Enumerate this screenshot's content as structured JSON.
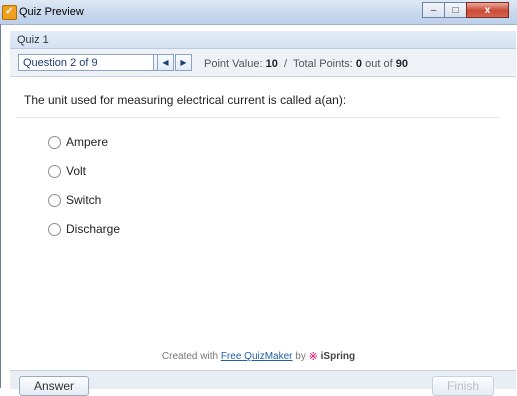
{
  "window": {
    "title": "Quiz Preview",
    "controls": [
      "–",
      "□",
      "x"
    ]
  },
  "quiz": {
    "name": "Quiz 1"
  },
  "toolbar": {
    "question_selector": "Question 2 of 9",
    "prev_glyph": "◀",
    "next_glyph": "▶",
    "point_value_label": "Point Value:",
    "point_value": "10",
    "separator": "/",
    "total_points_label": "Total Points:",
    "total_points": "0",
    "out_of_text": "out of",
    "max_points": "90"
  },
  "question": {
    "text": "The unit used for measuring electrical current is called a(an):",
    "options": [
      "Ampere",
      "Volt",
      "Switch",
      "Discharge"
    ]
  },
  "footer": {
    "created_with": "Created with",
    "link_text": "Free QuizMaker",
    "by_text": "by",
    "brand": "iSpring",
    "brand_mark": "※"
  },
  "buttons": {
    "answer": "Answer",
    "finish": "Finish"
  }
}
